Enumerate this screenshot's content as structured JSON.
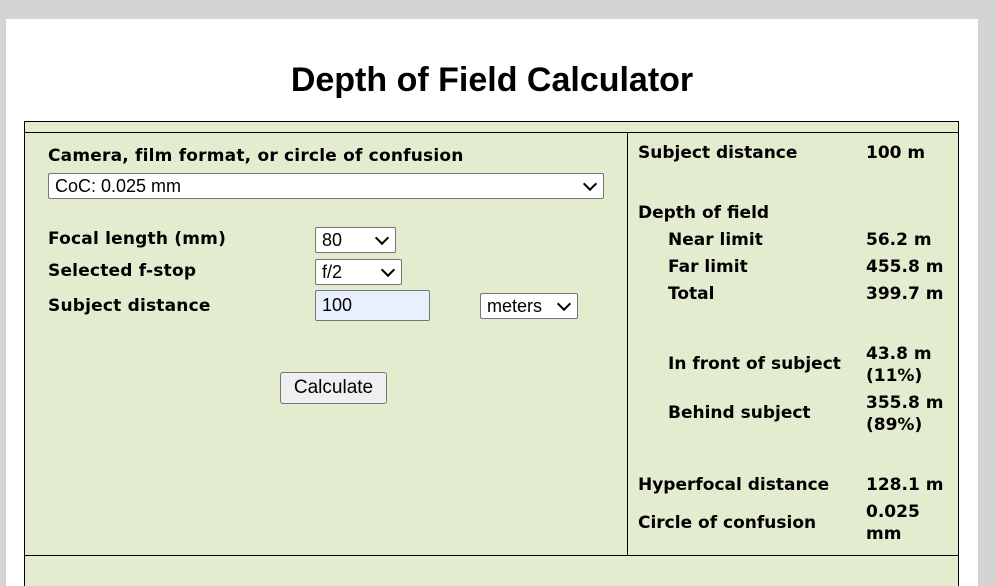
{
  "title": "Depth of Field Calculator",
  "form": {
    "camera_label": "Camera, film format, or circle of confusion",
    "camera_value": "CoC: 0.025 mm",
    "focal_label": "Focal length (mm)",
    "focal_value": "80",
    "fstop_label": "Selected f-stop",
    "fstop_value": "f/2",
    "distance_label": "Subject distance",
    "distance_value": "100",
    "unit_value": "meters",
    "calculate_label": "Calculate"
  },
  "results": {
    "subject_distance_label": "Subject distance",
    "subject_distance_value": "100 m",
    "dof_heading": "Depth of field",
    "near_label": "Near limit",
    "near_value": "56.2 m",
    "far_label": "Far limit",
    "far_value": "455.8 m",
    "total_label": "Total",
    "total_value": "399.7 m",
    "front_label": "In front of subject",
    "front_value": "43.8 m (11%)",
    "behind_label": "Behind subject",
    "behind_value": "355.8 m (89%)",
    "hyperfocal_label": "Hyperfocal distance",
    "hyperfocal_value": "128.1 m",
    "coc_label": "Circle of confusion",
    "coc_value": "0.025 mm"
  }
}
